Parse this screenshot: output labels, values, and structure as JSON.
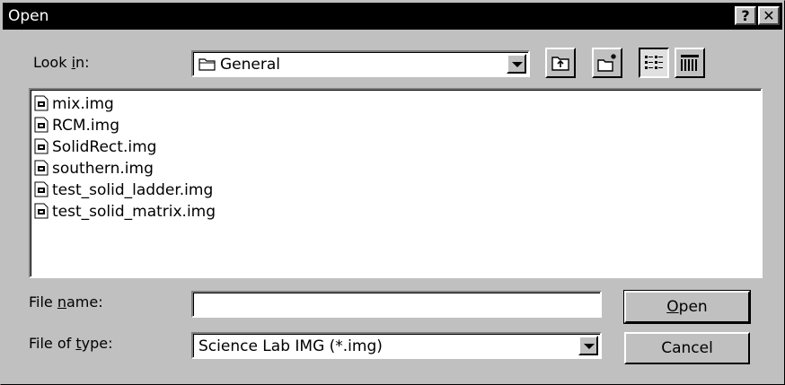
{
  "window": {
    "title": "Open",
    "help_label": "?",
    "close_label": "✕"
  },
  "look_in": {
    "label_pre": "Look ",
    "label_accel": "i",
    "label_post": "n:",
    "value": "General"
  },
  "toolbar": {
    "icons": [
      "up-one-level-icon",
      "create-new-folder-icon",
      "list-view-icon",
      "details-view-icon"
    ]
  },
  "files": [
    {
      "name": "mix.img"
    },
    {
      "name": "RCM.img"
    },
    {
      "name": "SolidRect.img"
    },
    {
      "name": "southern.img"
    },
    {
      "name": "test_solid_ladder.img"
    },
    {
      "name": "test_solid_matrix.img"
    }
  ],
  "file_name": {
    "label_pre": "File ",
    "label_accel": "n",
    "label_post": "ame:",
    "value": ""
  },
  "file_type": {
    "label_pre": "File of ",
    "label_accel": "t",
    "label_post": "ype:",
    "value": "Science Lab IMG (*.img)"
  },
  "buttons": {
    "open_accel": "O",
    "open_rest": "pen",
    "cancel": "Cancel"
  }
}
